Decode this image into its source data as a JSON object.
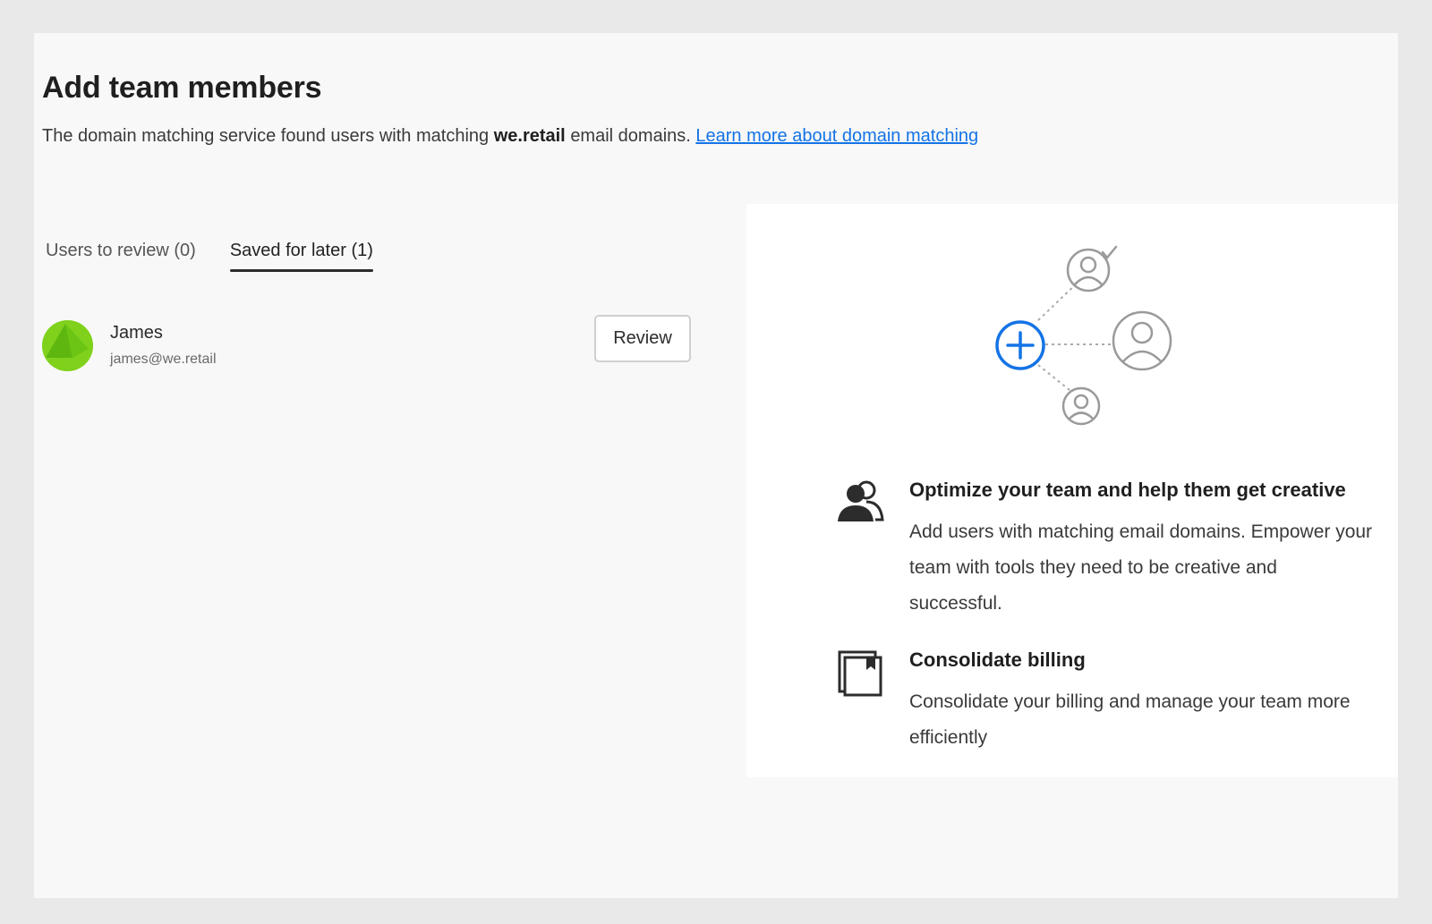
{
  "header": {
    "title": "Add team members",
    "subtitle_prefix": "The domain matching service found users with matching",
    "subtitle_domain": "we.retail",
    "subtitle_suffix": "email domains.",
    "learn_more_link": "Learn more about domain matching"
  },
  "tabs": [
    {
      "label": "Users to review (0)",
      "selected": false
    },
    {
      "label": "Saved for later (1)",
      "selected": true
    }
  ],
  "users": [
    {
      "name": "James",
      "email": "james@we.retail",
      "action_label": "Review",
      "avatar_color": "#7fd11b"
    }
  ],
  "info_panel": {
    "illustration_icons": [
      "add-user-icon",
      "user-check-icon",
      "user-icon"
    ],
    "accent_color": "#1473e6",
    "features": [
      {
        "icon": "users-icon",
        "title": "Optimize your team and help them get creative",
        "text": "Add users with matching email domains. Empower your team with tools they need to be creative and successful."
      },
      {
        "icon": "billing-icon",
        "title": "Consolidate billing",
        "text": "Consolidate your billing and manage your team more efficiently"
      }
    ]
  }
}
